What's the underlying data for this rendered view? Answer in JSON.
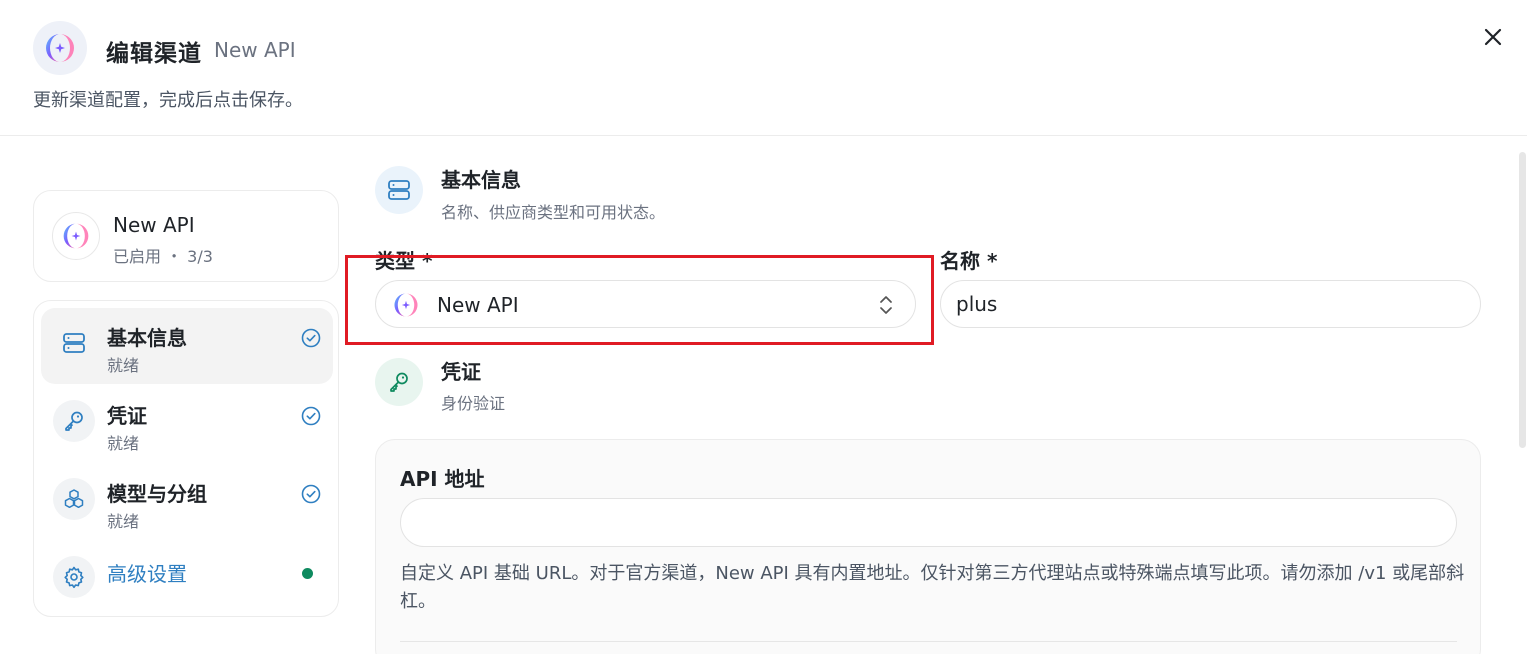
{
  "header": {
    "title": "编辑渠道",
    "subtitle": "New API",
    "description": "更新渠道配置，完成后点击保存。"
  },
  "summary": {
    "name": "New API",
    "status": "已启用 ・ 3/3"
  },
  "nav": {
    "items": [
      {
        "label": "基本信息",
        "state": "就绪"
      },
      {
        "label": "凭证",
        "state": "就绪"
      },
      {
        "label": "模型与分组",
        "state": "就绪"
      },
      {
        "label": "高级设置"
      }
    ]
  },
  "basic": {
    "title": "基本信息",
    "description": "名称、供应商类型和可用状态。",
    "type_label": "类型 *",
    "type_value": "New API",
    "name_label": "名称 *",
    "name_value": "plus"
  },
  "credentials": {
    "title": "凭证",
    "description": "身份验证",
    "api_label": "API 地址",
    "api_value": "",
    "api_help": "自定义 API 基础 URL。对于官方渠道，New API 具有内置地址。仅针对第三方代理站点或特殊端点填写此项。请勿添加 /v1 或尾部斜杠。"
  },
  "colors": {
    "accent_blue": "#2f7fc1",
    "success_green": "#0e8a5f",
    "highlight_red": "#e01b24"
  }
}
